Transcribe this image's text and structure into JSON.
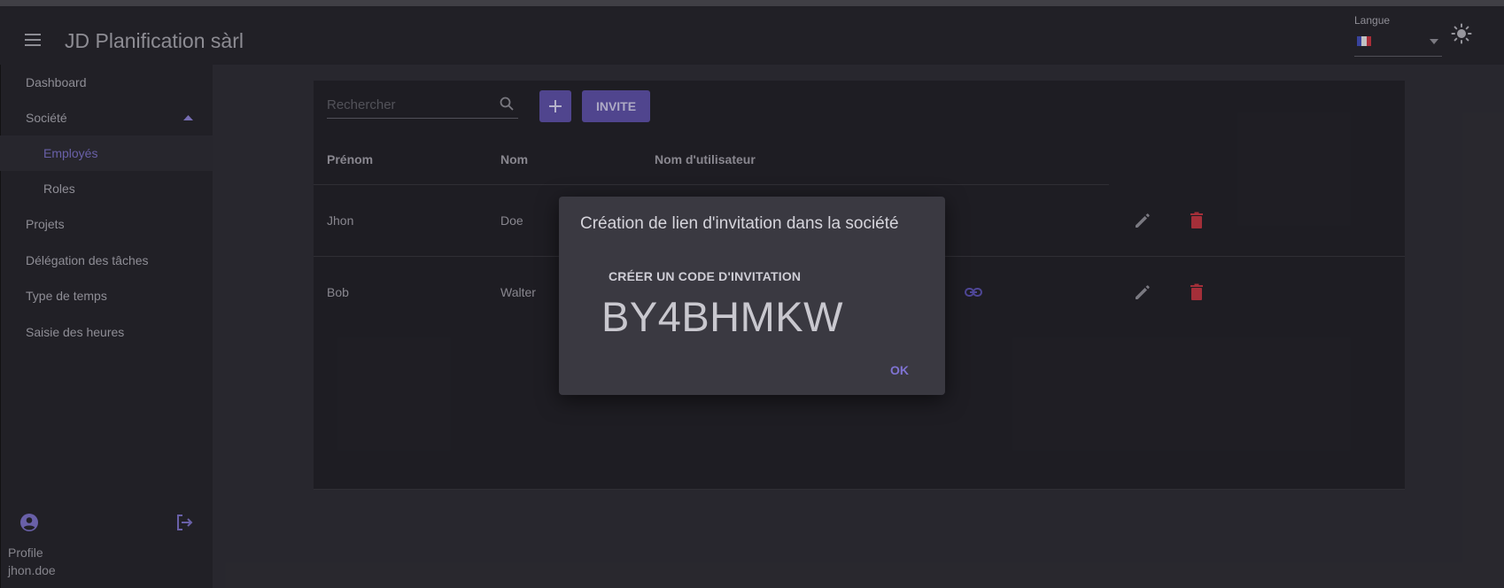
{
  "appbar": {
    "title": "JD Planification sàrl",
    "language_label": "Langue",
    "flag_colors": [
      "#3e4bb8",
      "#e6e6e6",
      "#c8313e"
    ]
  },
  "sidebar": {
    "items": [
      {
        "label": "Dashboard"
      },
      {
        "label": "Société"
      },
      {
        "label": "Employés"
      },
      {
        "label": "Roles"
      },
      {
        "label": "Projets"
      },
      {
        "label": "Délégation des tâches"
      },
      {
        "label": "Type de temps"
      },
      {
        "label": "Saisie des heures"
      }
    ],
    "profile_label": "Profile",
    "username": "jhon.doe"
  },
  "toolbar": {
    "search_placeholder": "Rechercher",
    "invite_label": "INVITE"
  },
  "table": {
    "headers": [
      "Prénom",
      "Nom",
      "Nom d'utilisateur"
    ],
    "rows": [
      {
        "first": "Jhon",
        "last": "Doe"
      },
      {
        "first": "Bob",
        "last": "Walter"
      }
    ]
  },
  "dialog": {
    "title": "Création de lien d'invitation dans la société",
    "subtitle": "CRÉER UN CODE D'INVITATION",
    "code": "BY4BHMKW",
    "ok_label": "OK"
  },
  "colors": {
    "accent": "#5c4fa6",
    "active_text": "#7a6fc6",
    "delete": "#c2343f",
    "link": "#5a50b0"
  }
}
